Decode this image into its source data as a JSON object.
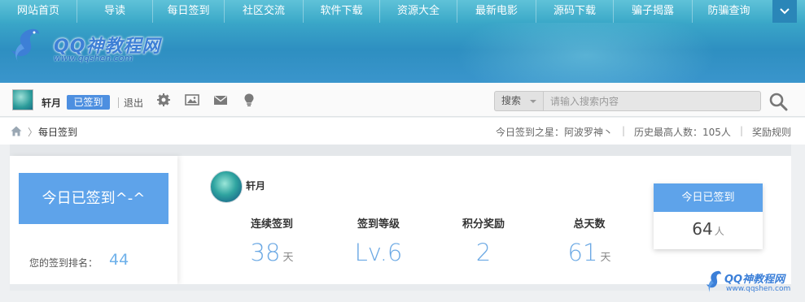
{
  "nav": {
    "items": [
      "网站首页",
      "导读",
      "每日签到",
      "社区交流",
      "软件下载",
      "资源大全",
      "最新电影",
      "源码下载",
      "骗子揭露",
      "防骗查询"
    ]
  },
  "logo": {
    "title": "QQ神教程网",
    "url": "www.qqshen.com"
  },
  "userbar": {
    "username": "轩月",
    "signed_badge": "已签到",
    "logout": "退出",
    "search_select": "搜索",
    "search_placeholder": "请输入搜索内容"
  },
  "breadcrumb": {
    "separator": "〉",
    "current": "每日签到",
    "star": "今日签到之星：阿波罗神丶",
    "history": "历史最高人数：105人",
    "rules": "奖励规则"
  },
  "sidebar": {
    "status": "今日已签到^-^",
    "rank_label": "您的签到排名：",
    "rank_value": "44"
  },
  "stats": {
    "username": "轩月",
    "items": [
      {
        "label": "连续签到",
        "value": "38",
        "unit": "天"
      },
      {
        "label": "签到等级",
        "value": "Lv.6",
        "unit": ""
      },
      {
        "label": "积分奖励",
        "value": "2",
        "unit": ""
      },
      {
        "label": "总天数",
        "value": "61",
        "unit": "天"
      }
    ]
  },
  "today": {
    "label": "今日已签到",
    "count": "64",
    "unit": "人"
  },
  "watermark": {
    "title": "QQ神教程网",
    "url": "www.qqshen.com"
  },
  "colors": {
    "accent": "#5ea3ea",
    "nav": "#3aa8c8",
    "value": "#6ca9e4"
  }
}
